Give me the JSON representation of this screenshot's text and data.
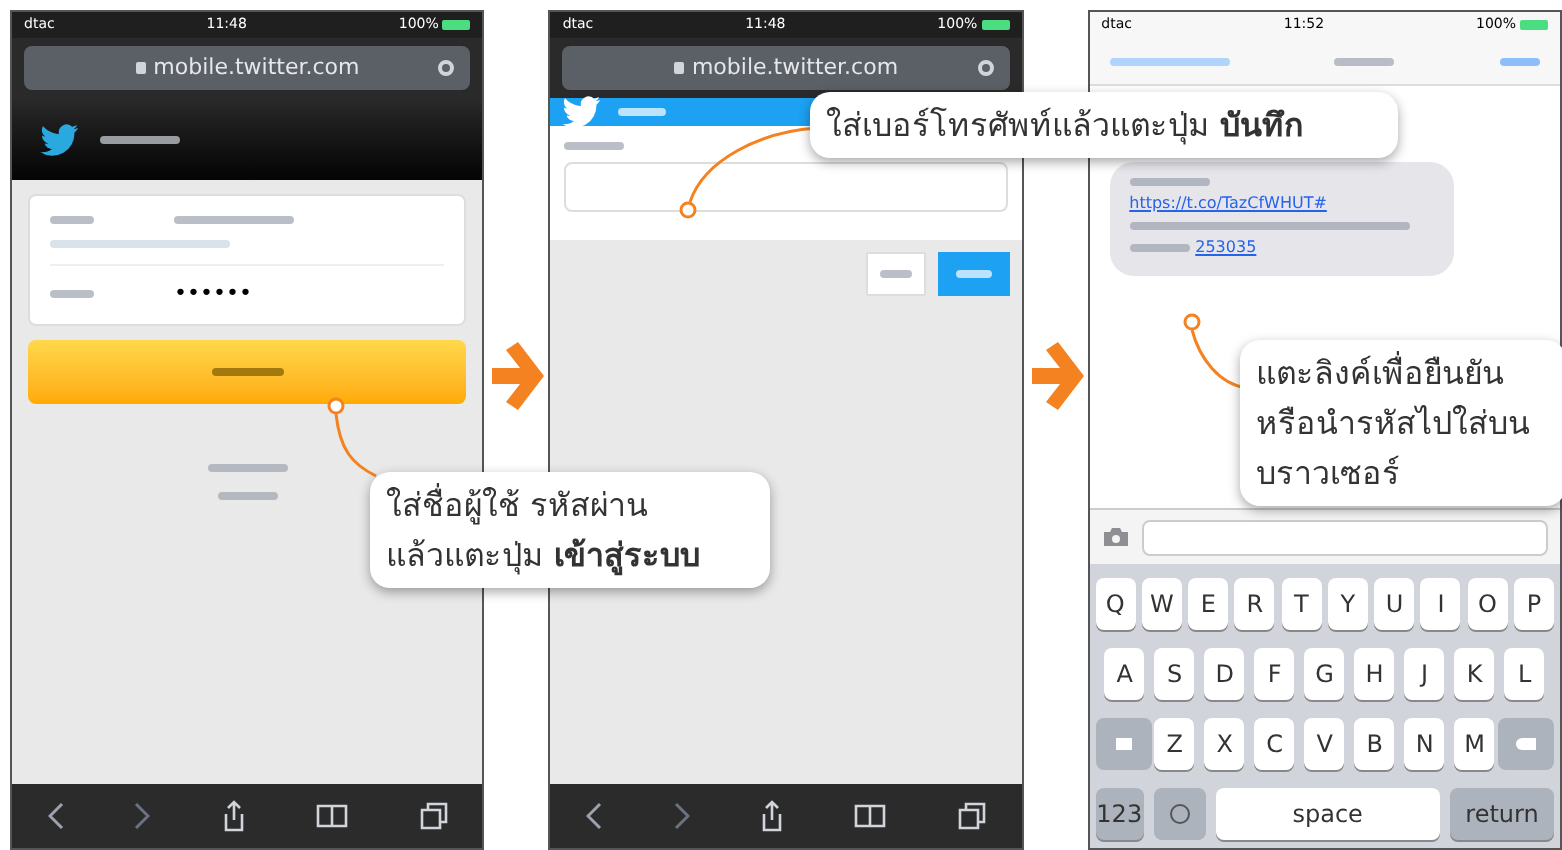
{
  "screens": [
    {
      "kind": "login",
      "status": {
        "carrier": "dtac",
        "time": "11:48",
        "battery": "100%"
      },
      "url": "mobile.twitter.com",
      "password": "••••••"
    },
    {
      "kind": "phone",
      "status": {
        "carrier": "dtac",
        "time": "11:48",
        "battery": "100%"
      },
      "url": "mobile.twitter.com"
    },
    {
      "kind": "sms",
      "status": {
        "carrier": "dtac",
        "time": "11:52",
        "battery": "100%"
      },
      "link": "https://t.co/TazCfWHUT#",
      "code": "253035",
      "keyboard": [
        [
          "Q",
          "W",
          "E",
          "R",
          "T",
          "Y",
          "U",
          "I",
          "O",
          "P"
        ],
        [
          "A",
          "S",
          "D",
          "F",
          "G",
          "H",
          "J",
          "K",
          "L"
        ],
        [
          "Z",
          "X",
          "C",
          "V",
          "B",
          "N",
          "M"
        ]
      ],
      "numbers_key": "123",
      "space_key": "space",
      "return_key": "return"
    }
  ],
  "callouts": [
    {
      "lines": [
        "ใส่ชื่อผู้ใช้ รหัสผ่าน",
        "แล้วแตะปุ่ม **เข้าสู่ระบบ**"
      ]
    },
    {
      "lines": [
        "ใส่เบอร์โทรศัพท์แล้วแตะปุ่ม **บันทึก**"
      ]
    },
    {
      "lines": [
        "แตะลิงค์เพื่อยืนยัน",
        "หรือนำรหัสไปใส่บน",
        "บราวเซอร์"
      ]
    }
  ]
}
